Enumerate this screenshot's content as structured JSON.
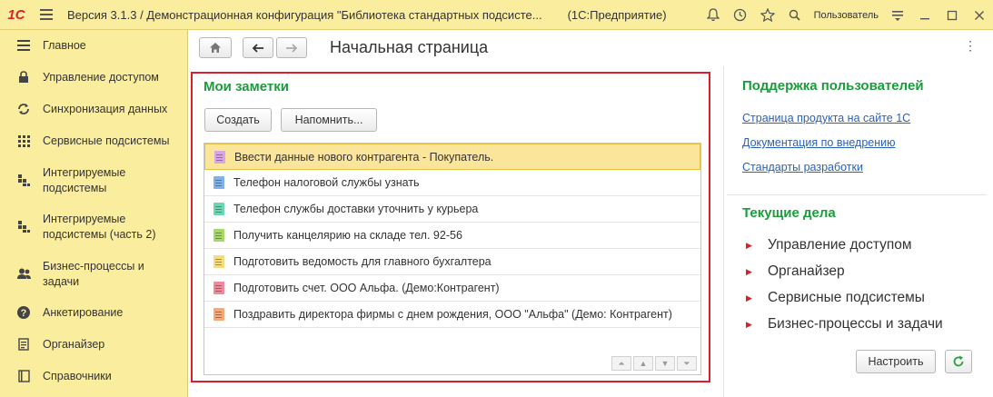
{
  "titlebar": {
    "logo": "1С",
    "title": "Версия 3.1.3 / Демонстрационная конфигурация \"Библиотека стандартных подсисте...",
    "app": "(1С:Предприятие)",
    "user": "Пользователь"
  },
  "sidebar": {
    "items": [
      {
        "label": "Главное",
        "icon": "menu-lines-icon"
      },
      {
        "label": "Управление доступом",
        "icon": "lock-icon"
      },
      {
        "label": "Синхронизация данных",
        "icon": "sync-icon"
      },
      {
        "label": "Сервисные подсистемы",
        "icon": "grid-icon"
      },
      {
        "label": "Интегрируемые подсистемы",
        "icon": "blocks-icon"
      },
      {
        "label": "Интегрируемые подсистемы (часть 2)",
        "icon": "blocks-icon"
      },
      {
        "label": "Бизнес-процессы и задачи",
        "icon": "users-icon"
      },
      {
        "label": "Анкетирование",
        "icon": "question-icon"
      },
      {
        "label": "Органайзер",
        "icon": "notepad-icon"
      },
      {
        "label": "Справочники",
        "icon": "book-icon"
      }
    ]
  },
  "main": {
    "page_title": "Начальная страница",
    "notes": {
      "title": "Мои заметки",
      "create_label": "Создать",
      "remind_label": "Напомнить...",
      "items": [
        {
          "text": "Ввести данные нового контрагента - Покупатель.",
          "color": "#d9a3e8"
        },
        {
          "text": "Телефон налоговой службы узнать",
          "color": "#7fb3e8"
        },
        {
          "text": "Телефон службы доставки уточнить у курьера",
          "color": "#6fd6b5"
        },
        {
          "text": "Получить канцелярию на складе тел. 92-56",
          "color": "#a6d96a"
        },
        {
          "text": "Подготовить ведомость для главного бухгалтера",
          "color": "#f6dc7a"
        },
        {
          "text": "Подготовить счет. ООО Альфа. (Демо:Контрагент)",
          "color": "#f08a9a"
        },
        {
          "text": "Поздравить директора фирмы с днем рождения, ООО \"Альфа\" (Демо: Контрагент)",
          "color": "#f5a878"
        }
      ]
    },
    "support": {
      "title": "Поддержка пользователей",
      "links": [
        "Страница продукта на сайте 1С",
        "Документация по внедрению",
        "Стандарты разработки"
      ]
    },
    "tasks": {
      "title": "Текущие дела",
      "items": [
        "Управление доступом",
        "Органайзер",
        "Сервисные подсистемы",
        "Бизнес-процессы и задачи"
      ],
      "configure_label": "Настроить"
    }
  }
}
